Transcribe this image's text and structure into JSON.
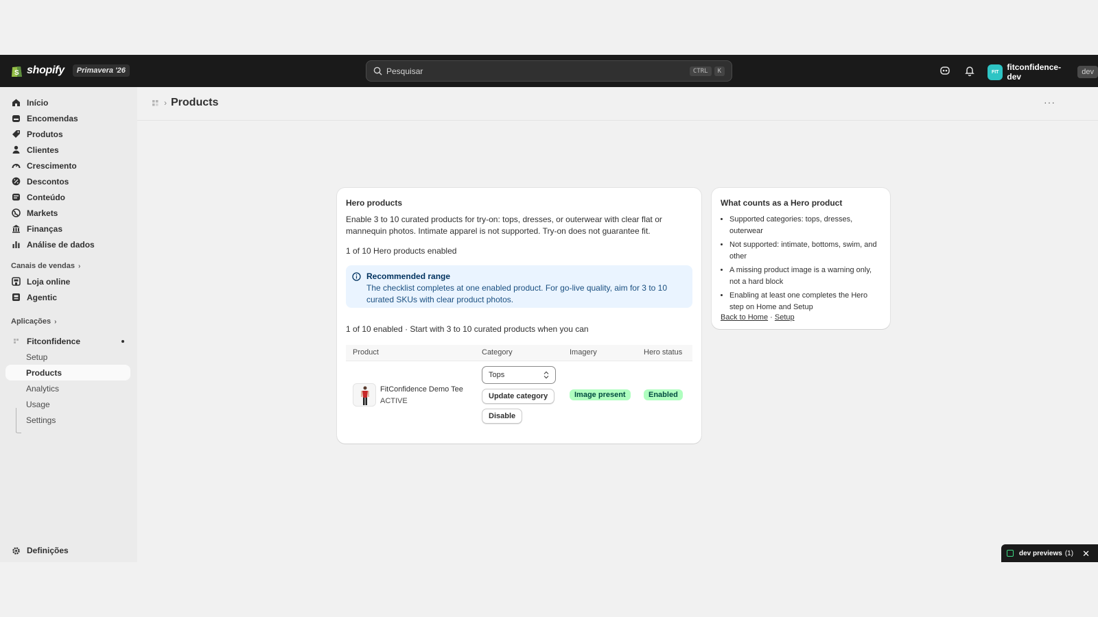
{
  "topbar": {
    "logo_text": "shopify",
    "edition": "Primavera '26",
    "search_placeholder": "Pesquisar",
    "kbd_ctrl": "CTRL",
    "kbd_k": "K",
    "store_initials": "FIT",
    "store_name": "fitconfidence-dev",
    "store_badge": "dev"
  },
  "sidebar": {
    "items": [
      {
        "label": "Início",
        "icon": "home-icon"
      },
      {
        "label": "Encomendas",
        "icon": "orders-icon"
      },
      {
        "label": "Produtos",
        "icon": "tag-icon"
      },
      {
        "label": "Clientes",
        "icon": "person-icon"
      },
      {
        "label": "Crescimento",
        "icon": "growth-icon"
      },
      {
        "label": "Descontos",
        "icon": "discount-icon"
      },
      {
        "label": "Conteúdo",
        "icon": "content-icon"
      },
      {
        "label": "Markets",
        "icon": "globe-icon"
      },
      {
        "label": "Finanças",
        "icon": "bank-icon"
      },
      {
        "label": "Análise de dados",
        "icon": "chart-icon"
      }
    ],
    "sales_channels_label": "Canais de vendas",
    "sales_channels": [
      {
        "label": "Loja online",
        "icon": "store-icon"
      },
      {
        "label": "Agentic",
        "icon": "agentic-icon"
      }
    ],
    "apps_label": "Aplicações",
    "app_name": "Fitconfidence",
    "app_subitems": [
      "Setup",
      "Products",
      "Analytics",
      "Usage",
      "Settings"
    ],
    "settings_label": "Definições"
  },
  "page": {
    "title": "Products"
  },
  "hero": {
    "title": "Hero products",
    "description": "Enable 3 to 10 curated products for try-on: tops, dresses, or outerwear with clear flat or mannequin photos. Intimate apparel is not supported. Try-on does not guarantee fit.",
    "count_text": "1 of 10 Hero products enabled",
    "banner_title": "Recommended range",
    "banner_text": "The checklist completes at one enabled product. For go-live quality, aim for 3 to 10 curated SKUs with clear product photos.",
    "summary_text": "1 of 10 enabled · Start with 3 to 10 curated products when you can",
    "columns": [
      "Product",
      "Category",
      "Imagery",
      "Hero status"
    ],
    "rows": [
      {
        "name": "FitConfidence Demo Tee",
        "status": "ACTIVE",
        "category": "Tops",
        "update_label": "Update category",
        "disable_label": "Disable",
        "imagery": "Image present",
        "hero_status": "Enabled"
      }
    ]
  },
  "side_card": {
    "title": "What counts as a Hero product",
    "bullets": [
      "Supported categories: tops, dresses, outerwear",
      "Not supported: intimate, bottoms, swim, and other",
      "A missing product image is a warning only, not a hard block",
      "Enabling at least one completes the Hero step on Home and Setup"
    ],
    "link_home": "Back to Home",
    "link_sep": "·",
    "link_setup": "Setup"
  },
  "toast": {
    "label": "dev previews",
    "count": "(1)"
  },
  "colors": {
    "topbar_bg": "#1a1a1a",
    "success_badge": "#affebf",
    "info_banner": "#eaf4ff",
    "avatar": "#2ec4c4"
  }
}
